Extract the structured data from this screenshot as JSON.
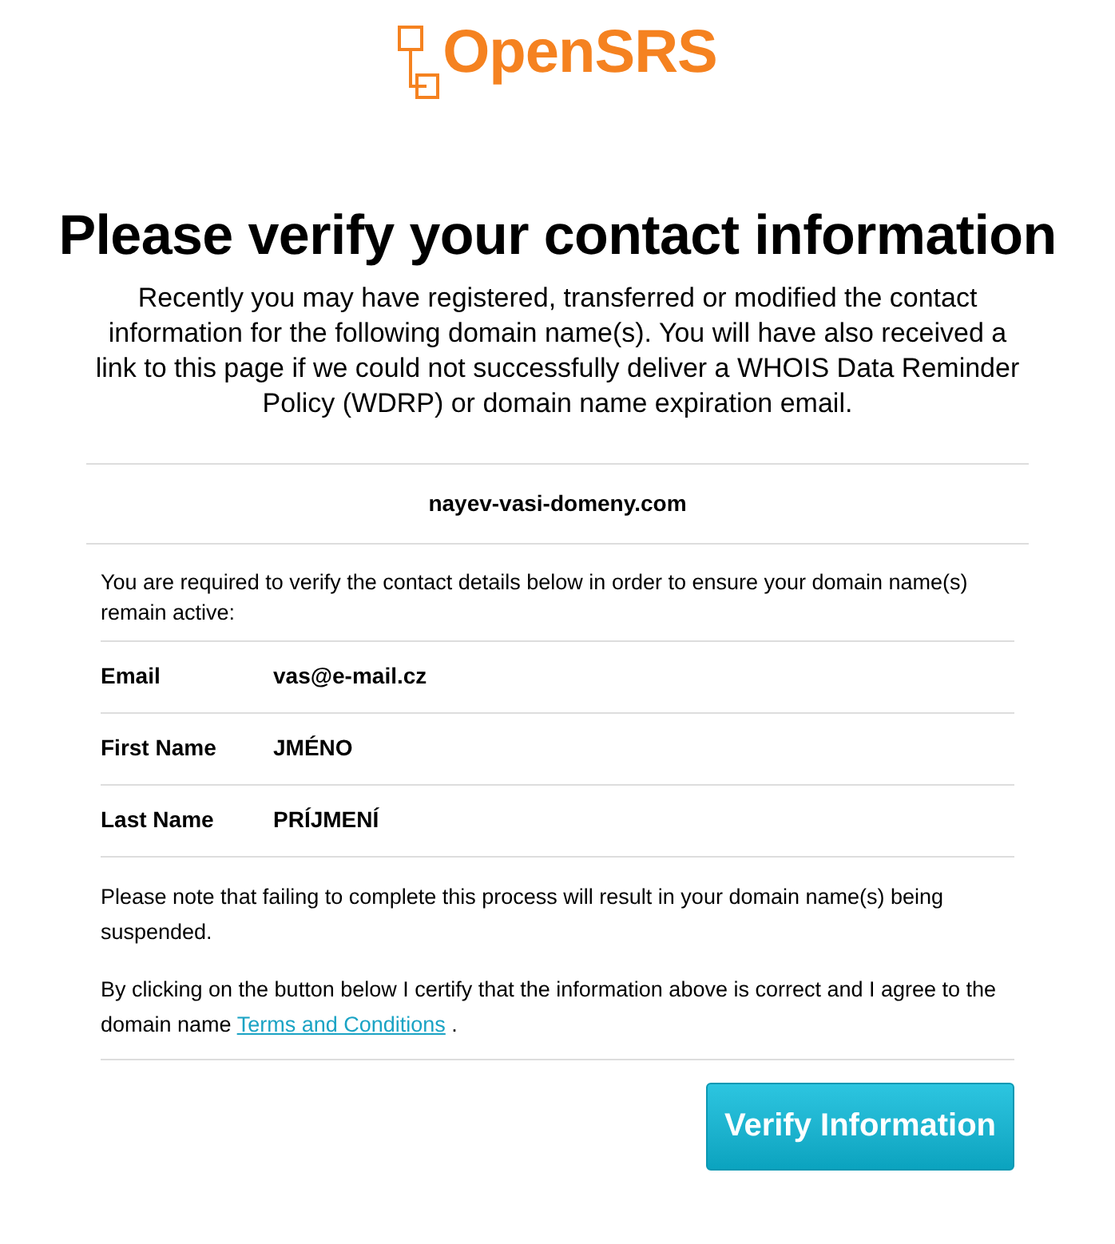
{
  "logo": {
    "text": "OpenSRS"
  },
  "heading": "Please verify your contact information",
  "intro": "Recently you may have registered, transferred or modified the contact information for the following domain name(s). You will have also received a link to this page if we could not successfully deliver a WHOIS Data Reminder Policy (WDRP) or domain name expiration email.",
  "domain": "nayev-vasi-domeny.com",
  "requirement": "You are required to verify the contact details below in order to ensure your domain name(s) remain active:",
  "contact_rows": [
    {
      "label": "Email",
      "value": "vas@e-mail.cz"
    },
    {
      "label": "First Name",
      "value": "JMÉNO"
    },
    {
      "label": "Last Name",
      "value": "PRÍJMENÍ"
    }
  ],
  "notice": "Please note that failing to complete this process will result in your domain name(s) being suspended.",
  "agreement": {
    "before": "By clicking on the button below I certify that the information above is correct and I agree to the domain name",
    "link": "Terms and Conditions",
    "after": "."
  },
  "button": "Verify Information"
}
